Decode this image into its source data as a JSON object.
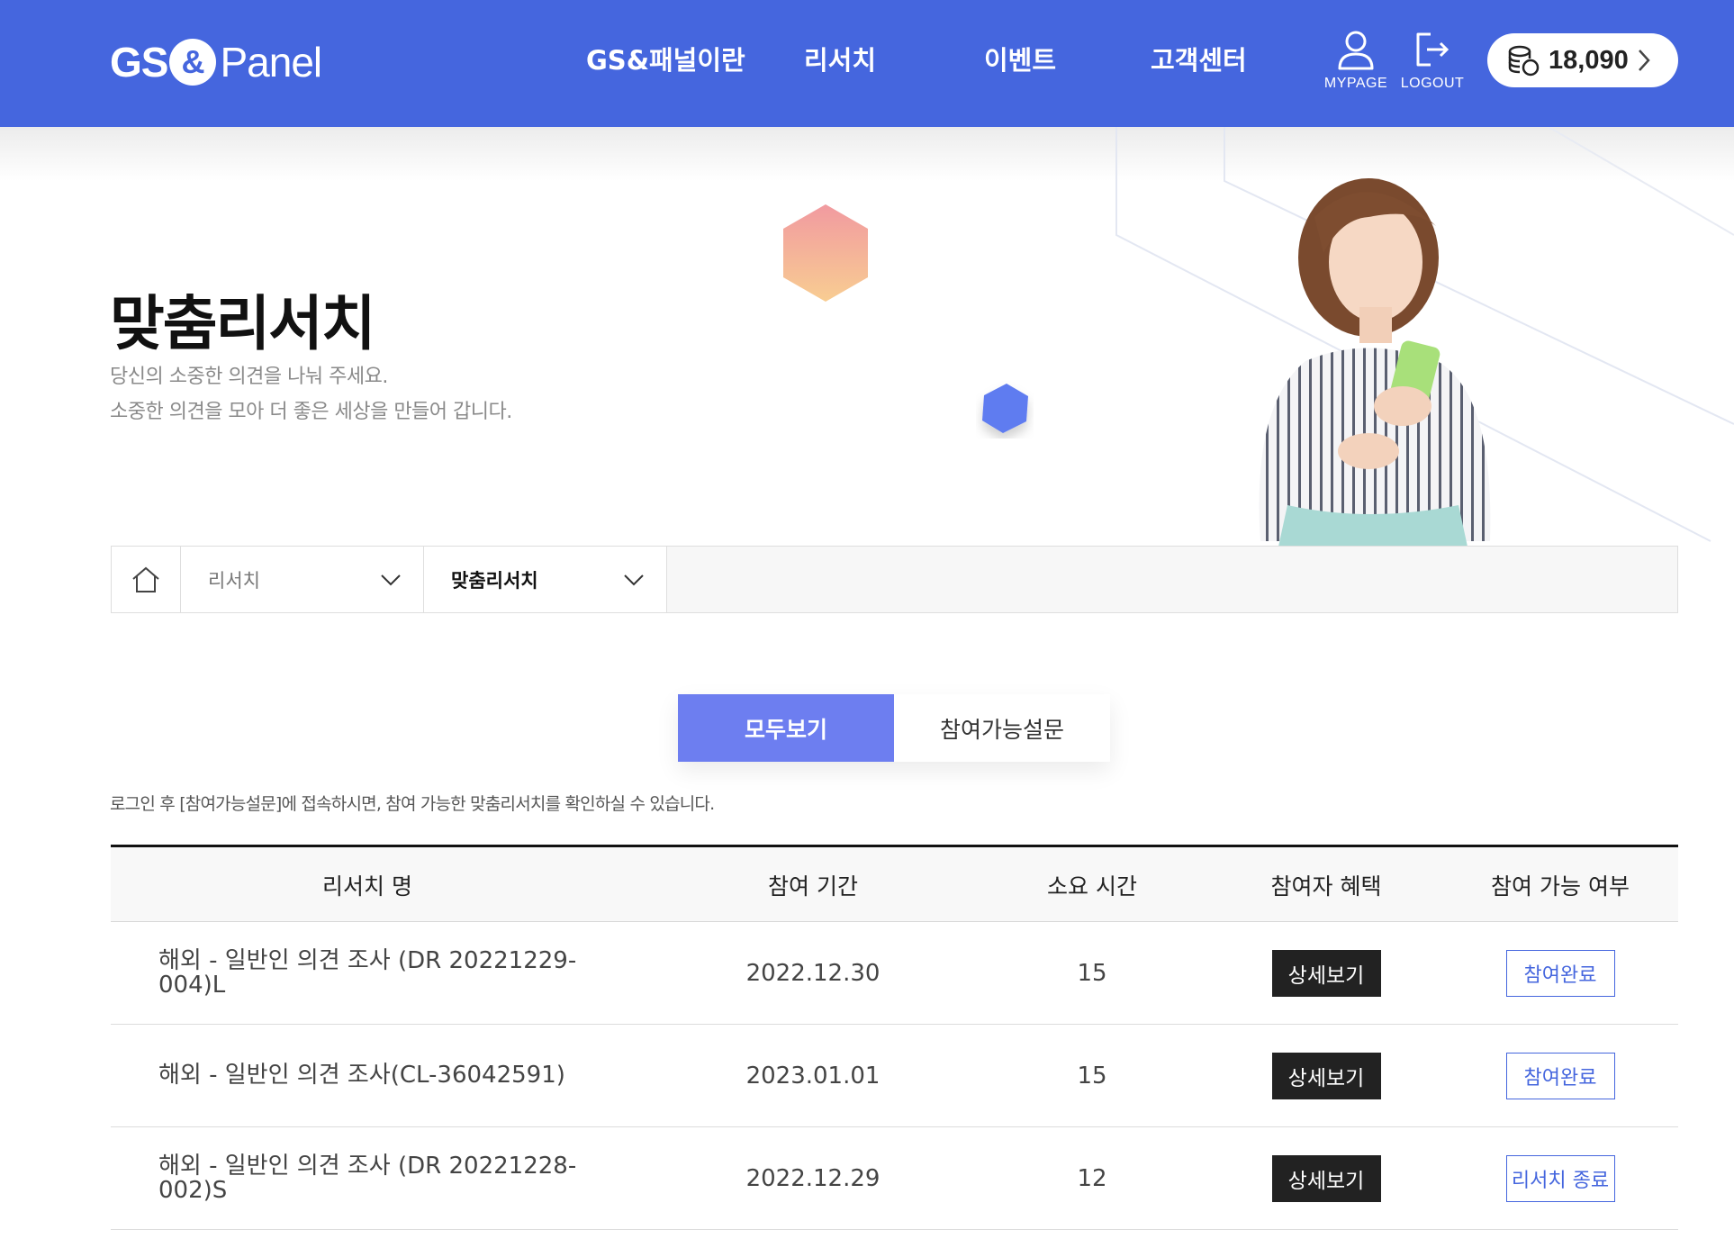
{
  "header": {
    "logo": {
      "gs": "GS",
      "amp": "&",
      "panel": "Panel"
    },
    "nav": [
      "GS&패널이란",
      "리서치",
      "이벤트",
      "고객센터"
    ],
    "mypage_label": "MYPAGE",
    "logout_label": "LOGOUT",
    "points": "18,090",
    "icons": {
      "mypage": "user-icon",
      "logout": "logout-icon",
      "points": "coins-icon",
      "points_arrow": "chevron-right-icon"
    }
  },
  "hero": {
    "title": "맞춤리서치",
    "subtitle_line1": "당신의 소중한 의견을 나눠 주세요.",
    "subtitle_line2": "소중한 의견을 모아 더 좋은 세상을 만들어 갑니다."
  },
  "breadcrumb": {
    "home_icon": "home-icon",
    "level1": "리서치",
    "level2": "맞춤리서치"
  },
  "tabs": [
    {
      "label": "모두보기",
      "active": true
    },
    {
      "label": "참여가능설문",
      "active": false
    }
  ],
  "notice": "로그인 후 [참여가능설문]에 접속하시면, 참여 가능한 맞춤리서치를 확인하실 수 있습니다.",
  "table": {
    "headers": [
      "리서치 명",
      "참여 기간",
      "소요 시간",
      "참여자 혜택",
      "참여 가능 여부"
    ],
    "rows": [
      {
        "name": "해외 - 일반인 의견 조사 (DR 20221229-004)L",
        "period": "2022.12.30",
        "time": "15",
        "benefit": "상세보기",
        "status": "참여완료"
      },
      {
        "name": "해외 - 일반인 의견 조사(CL-36042591)",
        "period": "2023.01.01",
        "time": "15",
        "benefit": "상세보기",
        "status": "참여완료"
      },
      {
        "name": "해외 - 일반인 의견 조사 (DR 20221228-002)S",
        "period": "2022.12.29",
        "time": "12",
        "benefit": "상세보기",
        "status": "리서치 종료"
      }
    ]
  },
  "colors": {
    "header_bg": "#4566de",
    "tab_active": "#6d7ef0",
    "status_blue": "#4566de",
    "detail_button": "#222222"
  }
}
